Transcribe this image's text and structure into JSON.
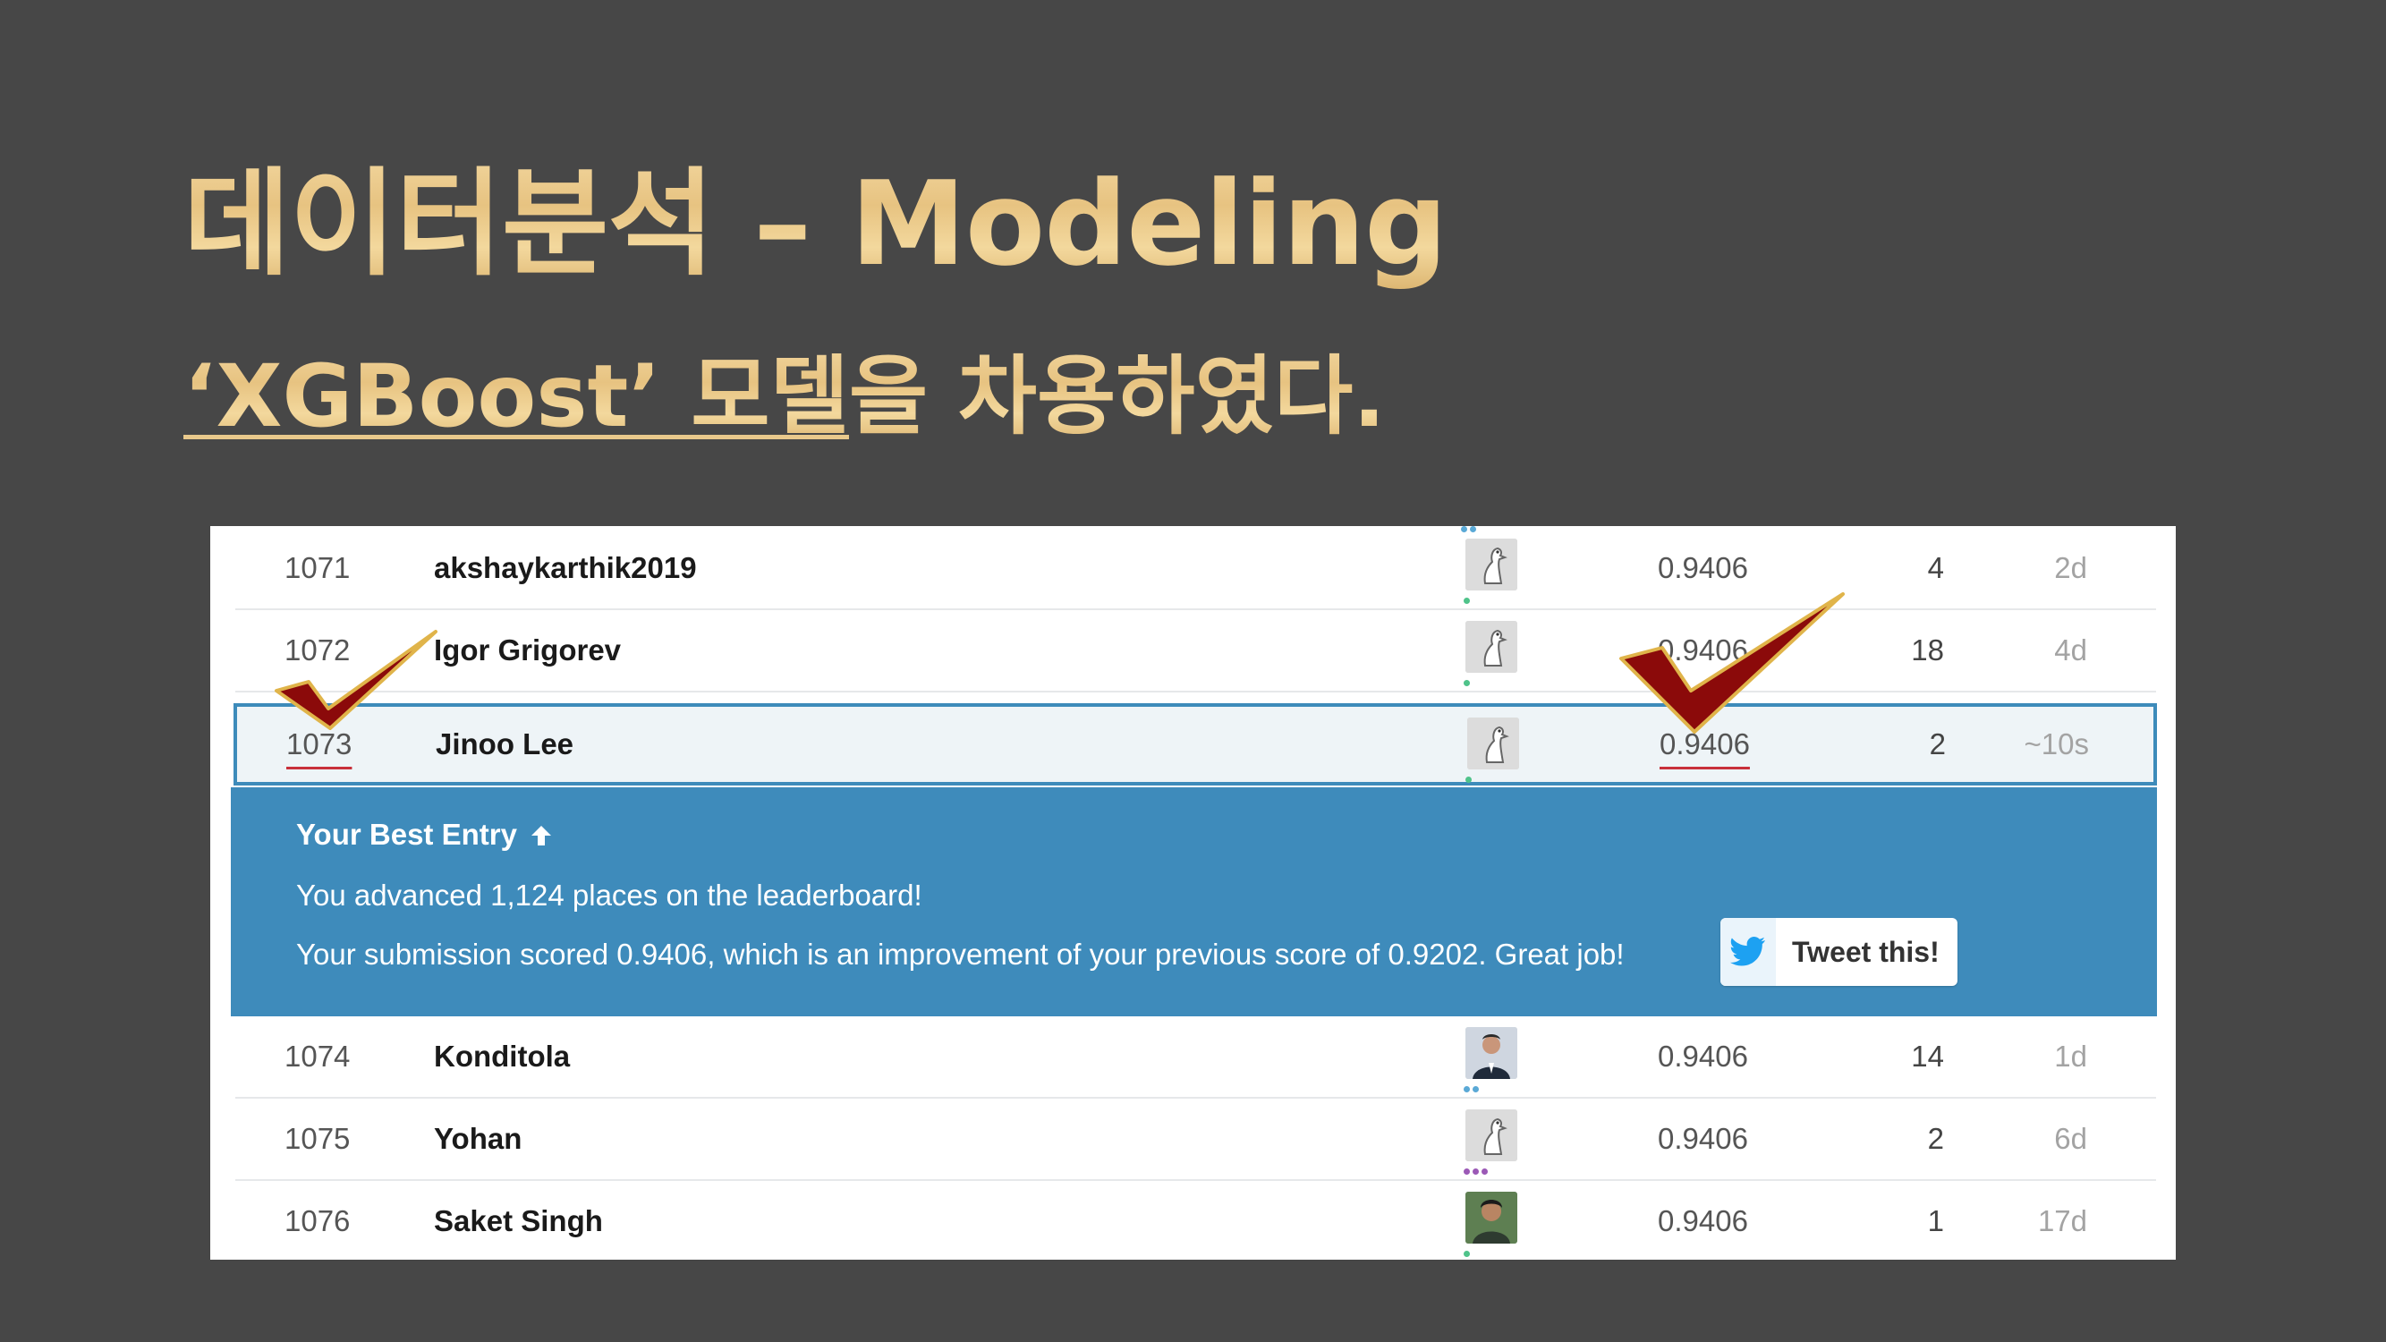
{
  "slide": {
    "title": "데이터분석 – Modeling",
    "subtitle_underlined": "‘XGBoost’ 모델",
    "subtitle_rest": "을 차용하였다."
  },
  "leaderboard": {
    "rows": [
      {
        "rank": "1071",
        "team": "akshaykarthik2019",
        "score": "0.9406",
        "entries": "4",
        "last": "2d",
        "avatar": "default-avatar",
        "tier_color": "#4fc38a"
      },
      {
        "rank": "1072",
        "team": "Igor Grigorev",
        "score": "0.9406",
        "entries": "18",
        "last": "4d",
        "avatar": "default-avatar",
        "tier_color": "#4fc38a"
      },
      {
        "rank": "1073",
        "team": "Jinoo Lee",
        "score": "0.9406",
        "entries": "2",
        "last": "~10s",
        "avatar": "default-avatar",
        "tier_color": "#4fc38a"
      },
      {
        "rank": "1074",
        "team": "Konditola",
        "score": "0.9406",
        "entries": "14",
        "last": "1d",
        "avatar": "photo-avatar",
        "tier_color": "#5aa9d6"
      },
      {
        "rank": "1075",
        "team": "Yohan",
        "score": "0.9406",
        "entries": "2",
        "last": "6d",
        "avatar": "default-avatar",
        "tier_color": "#9b59b6"
      },
      {
        "rank": "1076",
        "team": "Saket Singh",
        "score": "0.9406",
        "entries": "1",
        "last": "17d",
        "avatar": "photo-avatar",
        "tier_color": "#4fc38a"
      }
    ],
    "banner": {
      "title": "Your Best Entry",
      "line1": "You advanced 1,124 places on the leaderboard!",
      "line2": "Your submission scored 0.9406, which is an improvement of your previous score of 0.9202. Great job!",
      "tweet_label": "Tweet this!"
    }
  },
  "colors": {
    "slide_bg": "#474747",
    "banner_bg": "#3e8bbb",
    "highlight_border": "#3d8bba",
    "check_mark": "#8b0a0a",
    "check_outline": "#e0b44a"
  },
  "icons": [
    "up-arrow-icon",
    "twitter-bird-icon",
    "checkmark-icon"
  ]
}
